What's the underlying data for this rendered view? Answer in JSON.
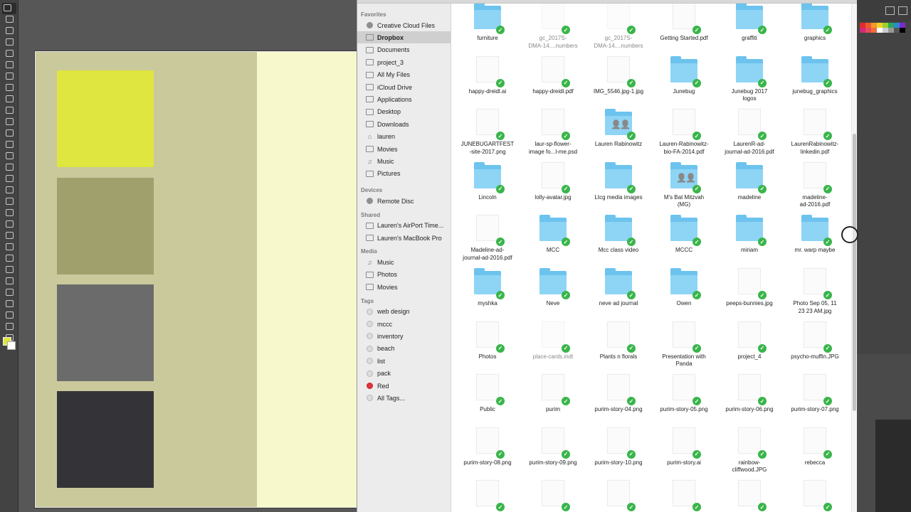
{
  "illustrator": {
    "swatches": [
      {
        "name": "swatch-yellow",
        "color": "#dee63f"
      },
      {
        "name": "swatch-olive",
        "color": "#a0a06c"
      },
      {
        "name": "swatch-gray",
        "color": "#6b6b6b"
      },
      {
        "name": "swatch-charcoal",
        "color": "#343438"
      }
    ],
    "artboard_colors": {
      "left": "#c9c99c",
      "right": "#f7f8cb"
    }
  },
  "finder": {
    "sidebar": {
      "favorites_header": "Favorites",
      "favorites": [
        {
          "label": "Creative Cloud Files",
          "icon": "creative-cloud-icon"
        },
        {
          "label": "Dropbox",
          "icon": "dropbox-icon",
          "selected": true
        },
        {
          "label": "Documents",
          "icon": "folder-icon"
        },
        {
          "label": "project_3",
          "icon": "folder-icon"
        },
        {
          "label": "All My Files",
          "icon": "all-files-icon"
        },
        {
          "label": "iCloud Drive",
          "icon": "cloud-icon"
        },
        {
          "label": "Applications",
          "icon": "applications-icon"
        },
        {
          "label": "Desktop",
          "icon": "desktop-icon"
        },
        {
          "label": "Downloads",
          "icon": "downloads-icon"
        },
        {
          "label": "lauren",
          "icon": "home-icon"
        },
        {
          "label": "Movies",
          "icon": "movies-icon"
        },
        {
          "label": "Music",
          "icon": "music-icon"
        },
        {
          "label": "Pictures",
          "icon": "pictures-icon"
        }
      ],
      "devices_header": "Devices",
      "devices": [
        {
          "label": "Remote Disc",
          "icon": "disc-icon"
        }
      ],
      "shared_header": "Shared",
      "shared": [
        {
          "label": "Lauren's AirPort Time...",
          "icon": "airport-icon"
        },
        {
          "label": "Lauren's MacBook Pro",
          "icon": "laptop-icon"
        }
      ],
      "media_header": "Media",
      "media": [
        {
          "label": "Music",
          "icon": "music-icon"
        },
        {
          "label": "Photos",
          "icon": "photos-icon"
        },
        {
          "label": "Movies",
          "icon": "movies-icon"
        }
      ],
      "tags_header": "Tags",
      "tags": [
        {
          "label": "web design",
          "color": "#dcdcdc"
        },
        {
          "label": "mccc",
          "color": "#dcdcdc"
        },
        {
          "label": "inventory",
          "color": "#dcdcdc"
        },
        {
          "label": "beach",
          "color": "#dcdcdc"
        },
        {
          "label": "list",
          "color": "#dcdcdc"
        },
        {
          "label": "pack",
          "color": "#dcdcdc"
        },
        {
          "label": "Red",
          "color": "#e0363a"
        },
        {
          "label": "All Tags...",
          "color": "#dcdcdc"
        }
      ]
    },
    "files": [
      {
        "name": "furniture",
        "type": "folder"
      },
      {
        "name": "gc_2017S-\nDMA-14....numbers",
        "type": "doc",
        "dim": true
      },
      {
        "name": "gc_2017S-\nDMA-14....numbers",
        "type": "doc",
        "dim": true
      },
      {
        "name": "Getting Started.pdf",
        "type": "doc"
      },
      {
        "name": "graffiti",
        "type": "folder"
      },
      {
        "name": "graphics",
        "type": "folder"
      },
      {
        "name": "happy-dreidl.ai",
        "type": "doc"
      },
      {
        "name": "happy-dreidl.pdf",
        "type": "doc"
      },
      {
        "name": "IMG_5546.jpg-1.jpg",
        "type": "doc"
      },
      {
        "name": "Junebug",
        "type": "folder"
      },
      {
        "name": "Junebug 2017\nlogos",
        "type": "folder"
      },
      {
        "name": "junebug_graphics",
        "type": "folder"
      },
      {
        "name": "JUNEBUGARTFEST\n-site-2017.png",
        "type": "doc"
      },
      {
        "name": "laur-sp-flower-\nimage fo...l-me.psd",
        "type": "doc"
      },
      {
        "name": "Lauren Rabinowitz",
        "type": "shared-folder"
      },
      {
        "name": "Lauren-Rabinowitz-\nbio-FA-2014.pdf",
        "type": "doc"
      },
      {
        "name": "LaurenR-ad-\njournal-ad-2016.pdf",
        "type": "doc"
      },
      {
        "name": "LaurenRabinowitz-\nlinkedin.pdf",
        "type": "doc"
      },
      {
        "name": "Lincoln",
        "type": "folder"
      },
      {
        "name": "lolly-avatar.jpg",
        "type": "doc"
      },
      {
        "name": "Ltcg media images",
        "type": "folder"
      },
      {
        "name": "M's Bat Mitzvah\n(MG)",
        "type": "shared-folder"
      },
      {
        "name": "madeline",
        "type": "folder"
      },
      {
        "name": "madeline-\nad-2016.pdf",
        "type": "doc"
      },
      {
        "name": "Madeline-ad-\njournal-ad-2016.pdf",
        "type": "doc"
      },
      {
        "name": "MCC",
        "type": "folder"
      },
      {
        "name": "Mcc class video",
        "type": "folder"
      },
      {
        "name": "MCCC",
        "type": "folder"
      },
      {
        "name": "miriam",
        "type": "folder"
      },
      {
        "name": "mr. warp maybe",
        "type": "folder"
      },
      {
        "name": "myshka",
        "type": "folder"
      },
      {
        "name": "Neve",
        "type": "folder"
      },
      {
        "name": "neve ad journal",
        "type": "folder"
      },
      {
        "name": "Owen",
        "type": "folder"
      },
      {
        "name": "peeps-bunnies.jpg",
        "type": "doc"
      },
      {
        "name": "Photo Sep 05, 11\n23 23 AM.jpg",
        "type": "doc"
      },
      {
        "name": "Photos",
        "type": "doc"
      },
      {
        "name": "place-cards.indt",
        "type": "doc",
        "dim": true
      },
      {
        "name": "Plants n florals",
        "type": "doc"
      },
      {
        "name": "Presentation with\nPanda",
        "type": "doc"
      },
      {
        "name": "project_4",
        "type": "doc"
      },
      {
        "name": "psycho-muffin.JPG",
        "type": "doc"
      },
      {
        "name": "Public",
        "type": "doc"
      },
      {
        "name": "purim",
        "type": "doc"
      },
      {
        "name": "purim-story-04.png",
        "type": "doc"
      },
      {
        "name": "purim-story-05.png",
        "type": "doc"
      },
      {
        "name": "purim-story-06.png",
        "type": "doc"
      },
      {
        "name": "purim-story-07.png",
        "type": "doc"
      },
      {
        "name": "purim-story-08.png",
        "type": "doc"
      },
      {
        "name": "purim-story-09.png",
        "type": "doc"
      },
      {
        "name": "purim-story-10.png",
        "type": "doc"
      },
      {
        "name": "purim-story.ai",
        "type": "doc"
      },
      {
        "name": "rainbow-\ncliffwood.JPG",
        "type": "doc"
      },
      {
        "name": "rebecca",
        "type": "doc"
      },
      {
        "name": "",
        "type": "doc"
      },
      {
        "name": "",
        "type": "doc"
      },
      {
        "name": "",
        "type": "doc"
      },
      {
        "name": "",
        "type": "doc"
      },
      {
        "name": "",
        "type": "doc"
      },
      {
        "name": "",
        "type": "doc"
      }
    ],
    "sync_status": "synced",
    "check_color": "#39b54a",
    "folder_color": "#6cc3ee"
  }
}
